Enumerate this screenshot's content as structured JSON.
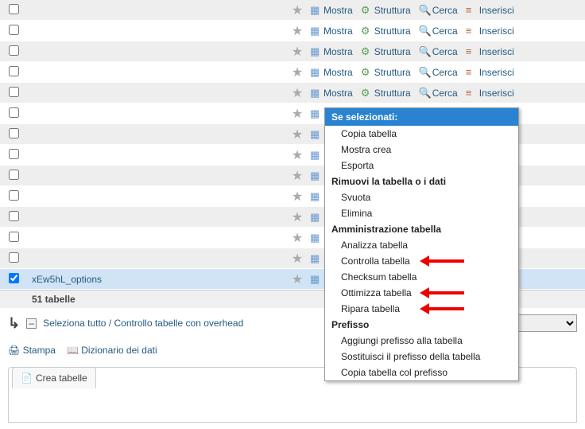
{
  "actions": {
    "mostra": "Mostra",
    "struttura": "Struttura",
    "cerca": "Cerca",
    "inserisci": "Inserisci"
  },
  "rows": [
    {
      "checked": false,
      "name": ""
    },
    {
      "checked": false,
      "name": ""
    },
    {
      "checked": false,
      "name": ""
    },
    {
      "checked": false,
      "name": ""
    },
    {
      "checked": false,
      "name": ""
    },
    {
      "checked": false,
      "name": ""
    },
    {
      "checked": false,
      "name": ""
    },
    {
      "checked": false,
      "name": ""
    },
    {
      "checked": false,
      "name": ""
    },
    {
      "checked": false,
      "name": ""
    },
    {
      "checked": false,
      "name": ""
    },
    {
      "checked": false,
      "name": ""
    },
    {
      "checked": false,
      "name": ""
    },
    {
      "checked": true,
      "name": "xEw5hL_options"
    }
  ],
  "totals": "51 tabelle",
  "toolbar": {
    "select_all": "Seleziona tutto / Controllo tabelle con overhead",
    "dropdown_label": "Se selezionati:"
  },
  "links": {
    "stampa": "Stampa",
    "dizionario": "Dizionario dei dati",
    "crea_tabelle": "Crea tabelle"
  },
  "menu": {
    "header": "Se selezionati:",
    "items": [
      {
        "t": "mi",
        "label": "Copia tabella"
      },
      {
        "t": "mi",
        "label": "Mostra crea"
      },
      {
        "t": "mi",
        "label": "Esporta"
      },
      {
        "t": "grp",
        "label": "Rimuovi la tabella o i dati"
      },
      {
        "t": "mi",
        "label": "Svuota"
      },
      {
        "t": "mi",
        "label": "Elimina"
      },
      {
        "t": "grp",
        "label": "Amministrazione tabella"
      },
      {
        "t": "mi",
        "label": "Analizza tabella"
      },
      {
        "t": "mi",
        "label": "Controlla tabella",
        "arrow": true
      },
      {
        "t": "mi",
        "label": "Checksum tabella"
      },
      {
        "t": "mi",
        "label": "Ottimizza tabella",
        "arrow": true
      },
      {
        "t": "mi",
        "label": "Ripara tabella",
        "arrow": true
      },
      {
        "t": "grp",
        "label": "Prefisso"
      },
      {
        "t": "mi",
        "label": "Aggiungi prefisso alla tabella"
      },
      {
        "t": "mi",
        "label": "Sostituisci il prefisso della tabella"
      },
      {
        "t": "mi",
        "label": "Copia tabella col prefisso"
      }
    ]
  },
  "icons": {
    "star": "★",
    "browse_color": "#6b9bd1",
    "structure_color": "#5a9e5a",
    "search_color": "#5a9e5a",
    "insert_color": "#b86b3a"
  }
}
